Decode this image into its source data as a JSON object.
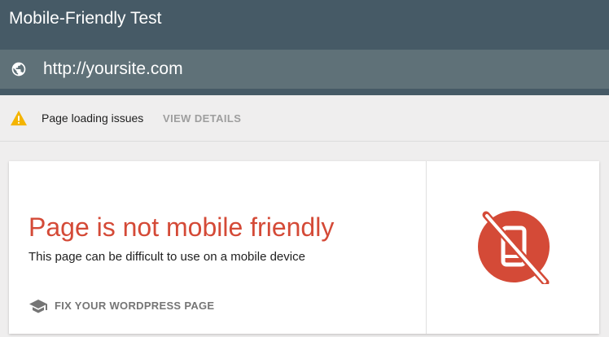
{
  "app": {
    "title": "Mobile-Friendly Test"
  },
  "url_bar": {
    "icon": "globe-icon",
    "value": "http://yoursite.com"
  },
  "issues_bar": {
    "icon": "warning-icon",
    "text": "Page loading issues",
    "action_label": "VIEW DETAILS"
  },
  "result": {
    "title": "Page is not mobile friendly",
    "subtitle": "This page can be difficult to use on a mobile device",
    "fix_icon": "graduation-cap-icon",
    "fix_label": "FIX YOUR WORDPRESS PAGE",
    "status_icon": "not-mobile-friendly-icon"
  },
  "colors": {
    "header": "#465a66",
    "url_bar": "#5f7178",
    "page_background": "#efeeee",
    "error_red": "#d44a37",
    "warning_yellow": "#f4b400"
  }
}
